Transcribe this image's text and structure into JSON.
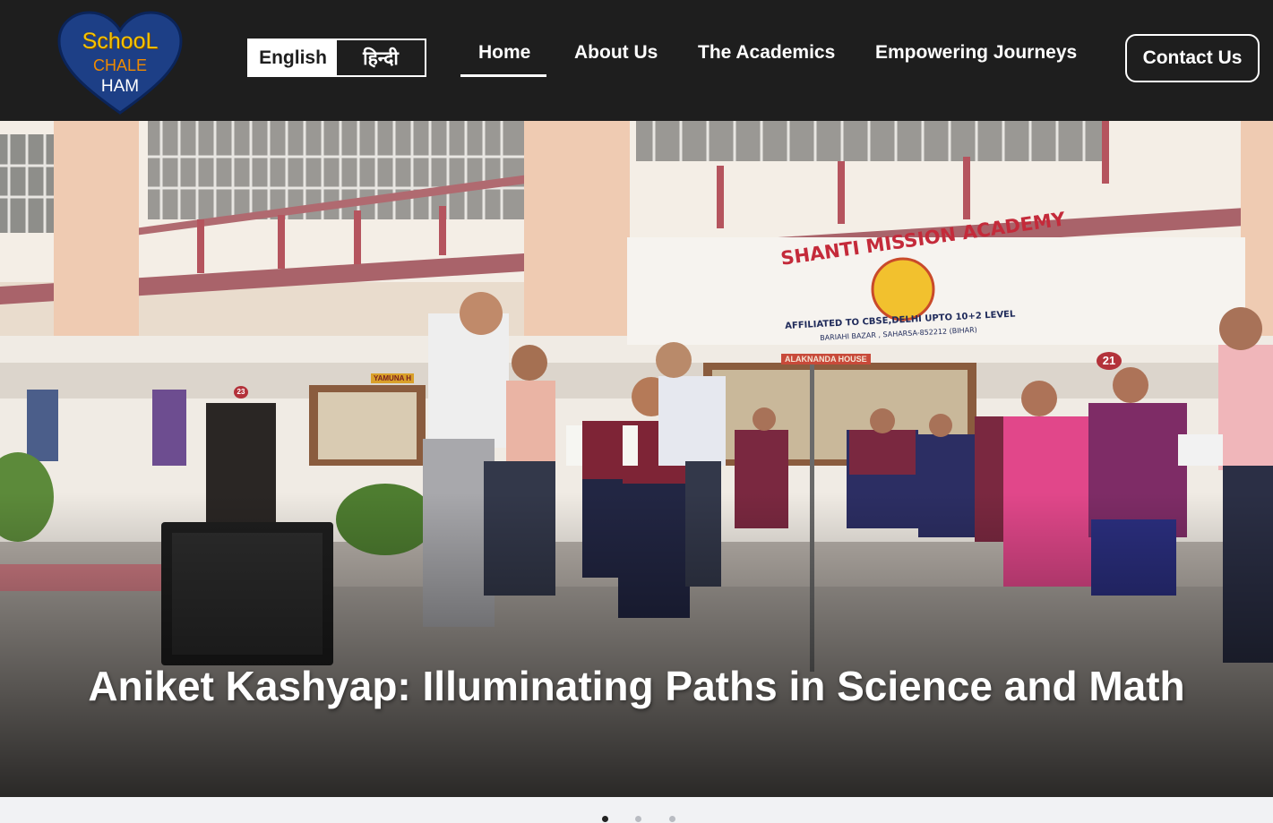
{
  "header": {
    "logo": {
      "line1": "SchooL",
      "line2": "CHALE",
      "line3": "HAM"
    },
    "language": {
      "english_label": "English",
      "hindi_label": "हिन्दी",
      "active": "English"
    },
    "nav": [
      {
        "label": "Home",
        "active": true
      },
      {
        "label": "About Us",
        "active": false
      },
      {
        "label": "The Academics",
        "active": false
      },
      {
        "label": "Empowering Journeys",
        "active": false
      }
    ],
    "contact_label": "Contact Us"
  },
  "hero": {
    "school_sign_title": "SHANTI MISSION ACADEMY",
    "school_sign_line1": "AFFILIATED TO CBSE,DELHI UPTO 10+2 LEVEL",
    "school_sign_line2": "BARIAHI BAZAR , SAHARSA-852212 (BIHAR)",
    "room_number_right": "21",
    "room_number_left": "23",
    "house_sign": "ALAKNANDA HOUSE",
    "house_sign_left": "YAMUNA H",
    "caption": "Aniket Kashyap: Illuminating Paths in Science and Math"
  },
  "carousel": {
    "slide_count": 3,
    "active_index": 0
  },
  "colors": {
    "header_bg": "#1e1e1e",
    "dot_active": "#222222",
    "dot_inactive": "#b9bcc2"
  }
}
